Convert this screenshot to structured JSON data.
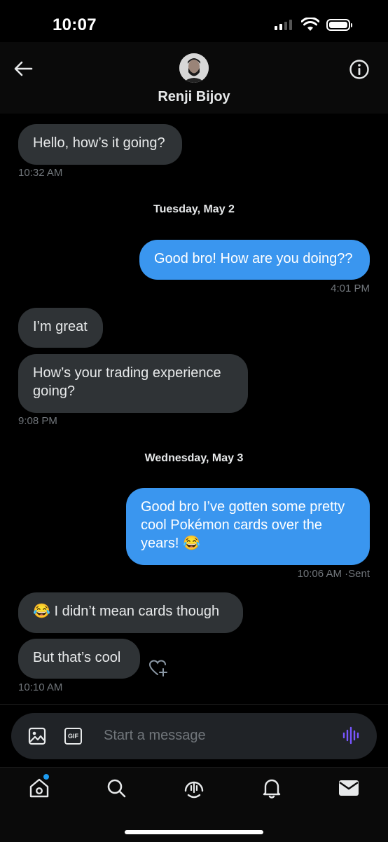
{
  "status_bar": {
    "time": "10:07"
  },
  "header": {
    "contact_name": "Renji Bijoy"
  },
  "messages": [
    {
      "text": "Hello, how’s it going?",
      "direction": "in"
    },
    {
      "stamp": "10:32 AM"
    },
    {
      "day": "Tuesday, May 2"
    },
    {
      "text": "Good bro! How are you doing??",
      "direction": "out"
    },
    {
      "stamp": "4:01 PM"
    },
    {
      "text": "I’m great",
      "direction": "in"
    },
    {
      "text": "How’s  your trading experience going?",
      "direction": "in"
    },
    {
      "stamp": "9:08 PM"
    },
    {
      "day": "Wednesday, May 3"
    },
    {
      "text": "Good bro I’ve gotten some pretty cool Pokémon cards over the years! 😂",
      "direction": "out"
    },
    {
      "stamp": "10:06 AM",
      "status": "·Sent"
    },
    {
      "text": "😂 I didn’t mean cards though",
      "direction": "in"
    },
    {
      "text": "But that’s cool",
      "direction": "in"
    },
    {
      "stamp": "10:10 AM"
    }
  ],
  "composer": {
    "placeholder": "Start a message",
    "gif_label": "GIF"
  },
  "colors": {
    "outgoing_bubble": "#3a96ef",
    "incoming_bubble": "#2f3336",
    "accent": "#1d9bf0",
    "voice": "#7856ff"
  },
  "icons": [
    "back-arrow-icon",
    "info-icon",
    "image-icon",
    "gif-icon",
    "voice-icon",
    "home-icon",
    "search-icon",
    "spaces-icon",
    "bell-icon",
    "mail-icon",
    "heart-plus-icon"
  ]
}
